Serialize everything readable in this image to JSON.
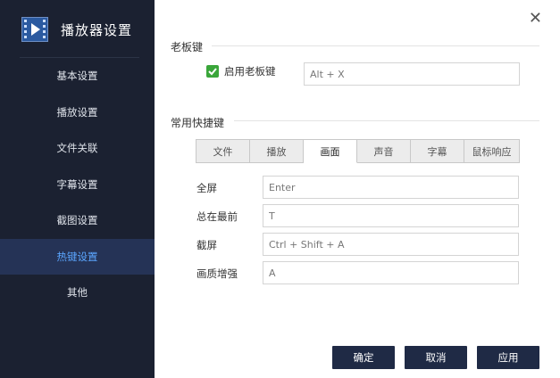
{
  "app": {
    "title": "播放器设置"
  },
  "sidebar": {
    "items": [
      {
        "label": "基本设置"
      },
      {
        "label": "播放设置"
      },
      {
        "label": "文件关联"
      },
      {
        "label": "字幕设置"
      },
      {
        "label": "截图设置"
      },
      {
        "label": "热键设置",
        "active": true
      },
      {
        "label": "其他"
      }
    ]
  },
  "boss_key": {
    "section_title": "老板键",
    "checkbox_label": "启用老板键",
    "checked": true,
    "value": "Alt + X"
  },
  "shortcuts": {
    "section_title": "常用快捷键",
    "tabs": [
      "文件",
      "播放",
      "画面",
      "声音",
      "字幕",
      "鼠标响应"
    ],
    "active_tab": "画面",
    "rows": [
      {
        "label": "全屏",
        "value": "Enter"
      },
      {
        "label": "总在最前",
        "value": "T"
      },
      {
        "label": "截屏",
        "value": "Ctrl + Shift + A"
      },
      {
        "label": "画质增强",
        "value": "A"
      }
    ]
  },
  "buttons": {
    "ok": "确定",
    "cancel": "取消",
    "apply": "应用"
  },
  "colors": {
    "sidebar_bg": "#1b2131",
    "active_item_bg": "#253356",
    "active_item_text": "#5ba6ff",
    "checkbox": "#3aa63a",
    "button_bg": "#1f2a45"
  }
}
